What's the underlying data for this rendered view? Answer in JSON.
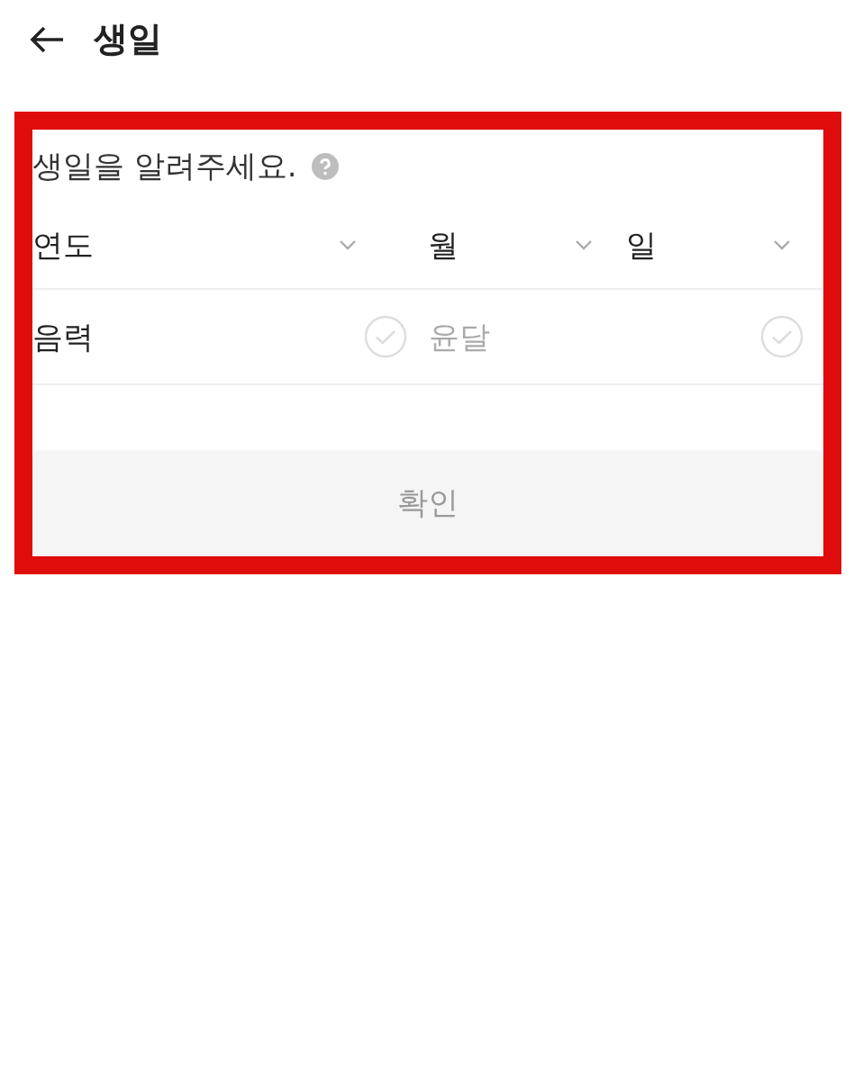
{
  "header": {
    "title": "생일"
  },
  "form": {
    "prompt": "생일을 알려주세요.",
    "selects": [
      {
        "label": "연도",
        "kind": "year"
      },
      {
        "label": "월",
        "kind": "month"
      },
      {
        "label": "일",
        "kind": "day"
      }
    ],
    "options": [
      {
        "label": "음력",
        "checked": false,
        "disabled": false
      },
      {
        "label": "윤달",
        "checked": false,
        "disabled": true
      }
    ],
    "submit": {
      "label": "확인",
      "disabled": true
    }
  }
}
